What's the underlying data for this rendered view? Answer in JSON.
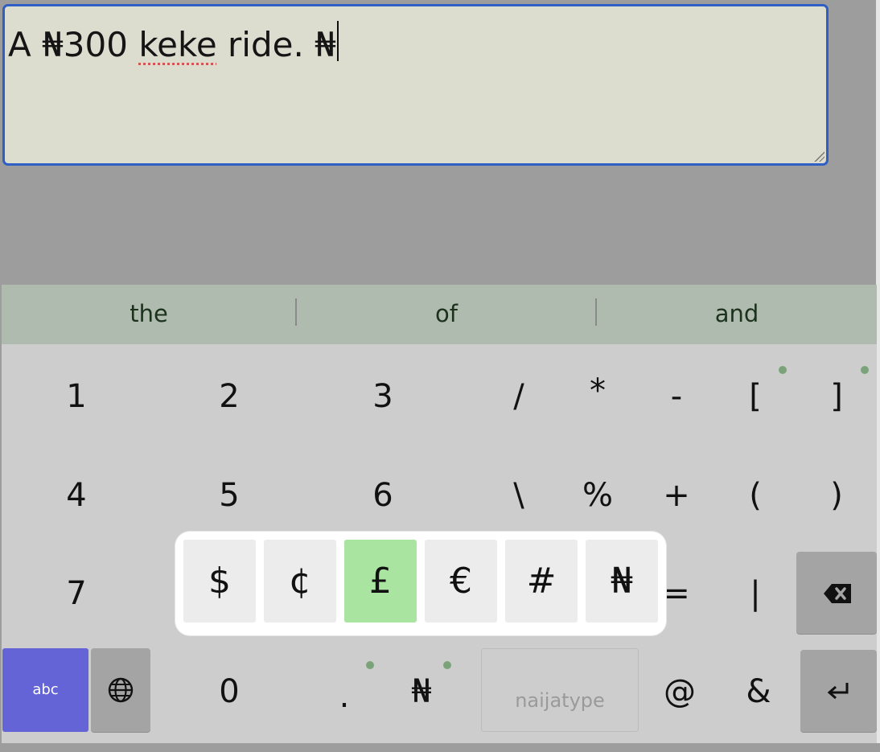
{
  "editor": {
    "text_before": "A ₦300 ",
    "misspelled": "keke",
    "text_after": " ride. ₦"
  },
  "suggestions": [
    "the",
    "of",
    "and"
  ],
  "keys": {
    "row1": [
      "1",
      "2",
      "3",
      "/",
      "*",
      "-",
      "[",
      "]"
    ],
    "row2": [
      "4",
      "5",
      "6",
      "\\",
      "%",
      "+",
      "(",
      ")"
    ],
    "row3_left": "7",
    "row3_right": [
      "=",
      "|"
    ],
    "row4": {
      "abc": "abc",
      "zero": "0",
      "period": ".",
      "naira": "₦",
      "space": "naijatype",
      "at": "@",
      "amp": "&"
    }
  },
  "popup": {
    "options": [
      "$",
      "¢",
      "£",
      "€",
      "#",
      "₦"
    ],
    "selected": "£"
  },
  "colors": {
    "accent_blue": "#2f5fc4",
    "abc_key": "#6464d6",
    "suggestion_bar": "#aebbae",
    "popup_selected": "#a9e4a0",
    "dot": "#7aa37a"
  },
  "icons": {
    "backspace": "backspace-icon",
    "globe": "globe-icon",
    "enter": "enter-icon"
  }
}
